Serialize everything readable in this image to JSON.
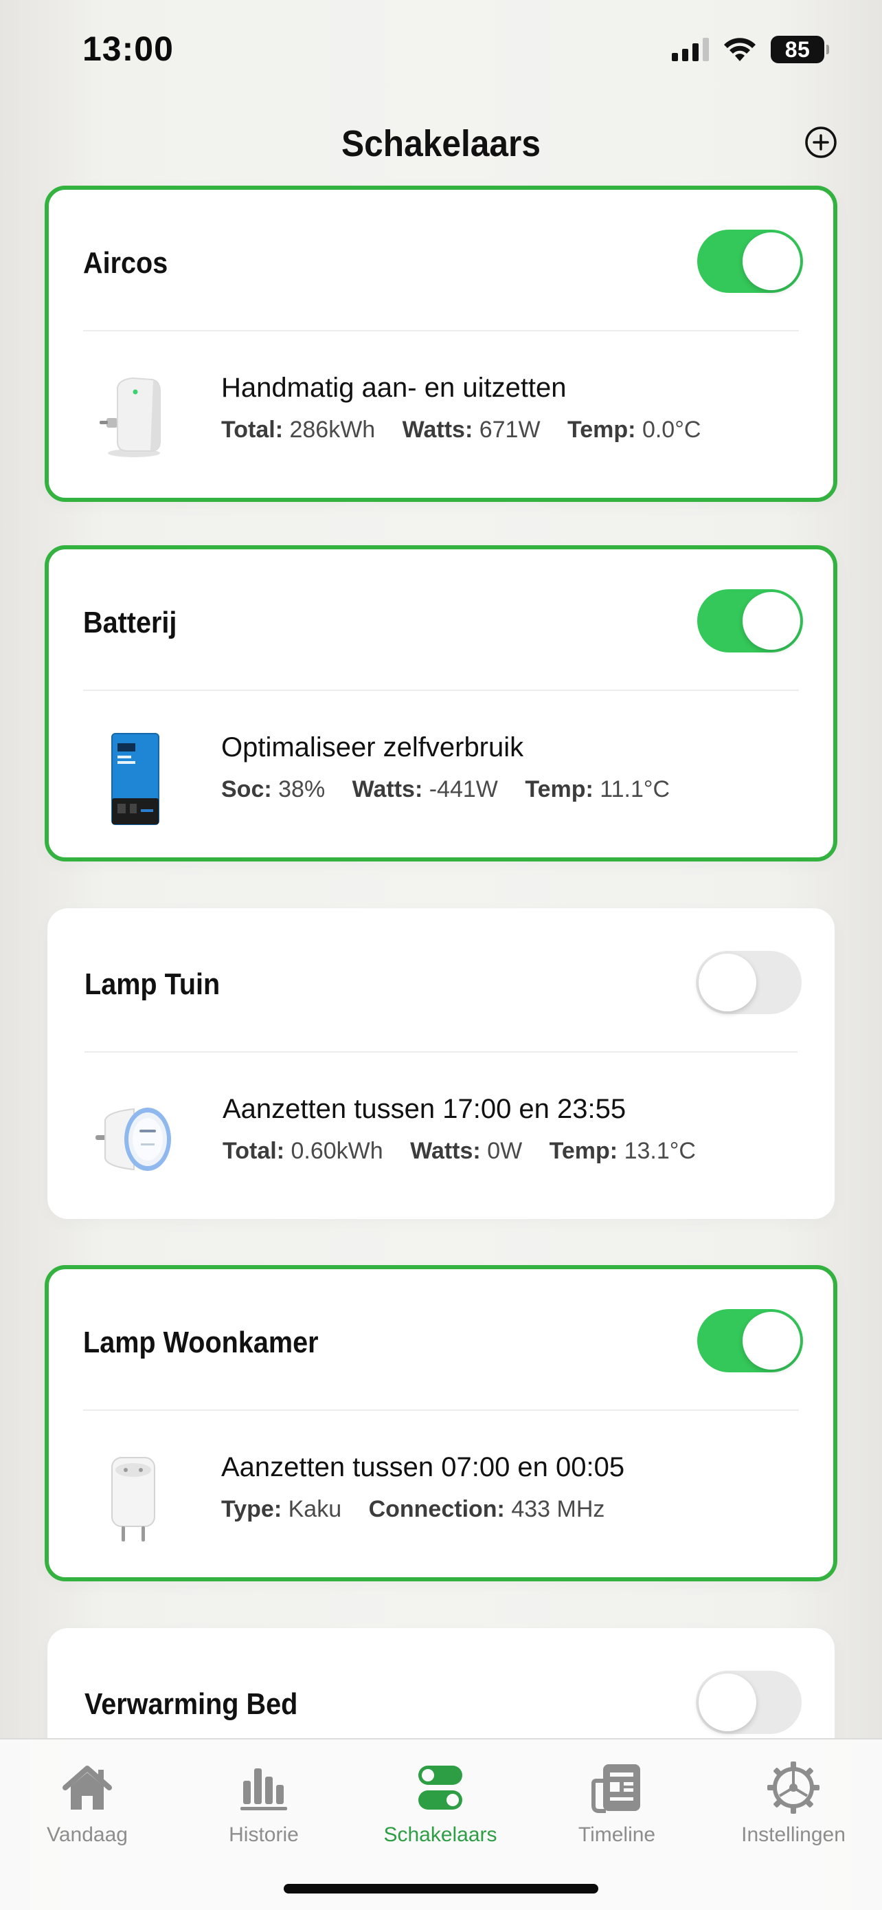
{
  "status_bar": {
    "time": "13:00",
    "battery": "85",
    "icons": [
      "signal-icon",
      "wifi-icon",
      "battery-icon"
    ]
  },
  "header": {
    "title": "Schakelaars",
    "add_icon": "plus-circle-icon"
  },
  "colors": {
    "accent_green": "#34b23f",
    "toggle_on": "#34c759",
    "toggle_off": "#e9e9ea",
    "tab_active": "#2e9e44",
    "tab_inactive": "#8d8d8d"
  },
  "cards": [
    {
      "title": "Aircos",
      "on": true,
      "device_icon": "smart-plug-image",
      "description": "Handmatig aan- en uitzetten",
      "stats": [
        {
          "label": "Total:",
          "value": "286kWh"
        },
        {
          "label": "Watts:",
          "value": "671W"
        },
        {
          "label": "Temp:",
          "value": "0.0°C"
        }
      ]
    },
    {
      "title": "Batterij",
      "on": true,
      "device_icon": "battery-inverter-image",
      "description": "Optimaliseer zelfverbruik",
      "stats": [
        {
          "label": "Soc:",
          "value": "38%"
        },
        {
          "label": "Watts:",
          "value": "-441W"
        },
        {
          "label": "Temp:",
          "value": "11.1°C"
        }
      ]
    },
    {
      "title": "Lamp Tuin",
      "on": false,
      "device_icon": "shelly-plug-image",
      "description": "Aanzetten tussen 17:00 en 23:55",
      "stats": [
        {
          "label": "Total:",
          "value": "0.60kWh"
        },
        {
          "label": "Watts:",
          "value": "0W"
        },
        {
          "label": "Temp:",
          "value": "13.1°C"
        }
      ]
    },
    {
      "title": "Lamp Woonkamer",
      "on": true,
      "device_icon": "kaku-plug-image",
      "description": "Aanzetten tussen 07:00 en 00:05",
      "stats": [
        {
          "label": "Type:",
          "value": "Kaku"
        },
        {
          "label": "Connection:",
          "value": "433 MHz"
        }
      ]
    },
    {
      "title": "Verwarming Bed",
      "on": false
    }
  ],
  "tabs": [
    {
      "label": "Vandaag",
      "icon": "house-icon",
      "active": false
    },
    {
      "label": "Historie",
      "icon": "bar-chart-icon",
      "active": false
    },
    {
      "label": "Schakelaars",
      "icon": "switches-icon",
      "active": true
    },
    {
      "label": "Timeline",
      "icon": "newspaper-icon",
      "active": false
    },
    {
      "label": "Instellingen",
      "icon": "gear-icon",
      "active": false
    }
  ]
}
